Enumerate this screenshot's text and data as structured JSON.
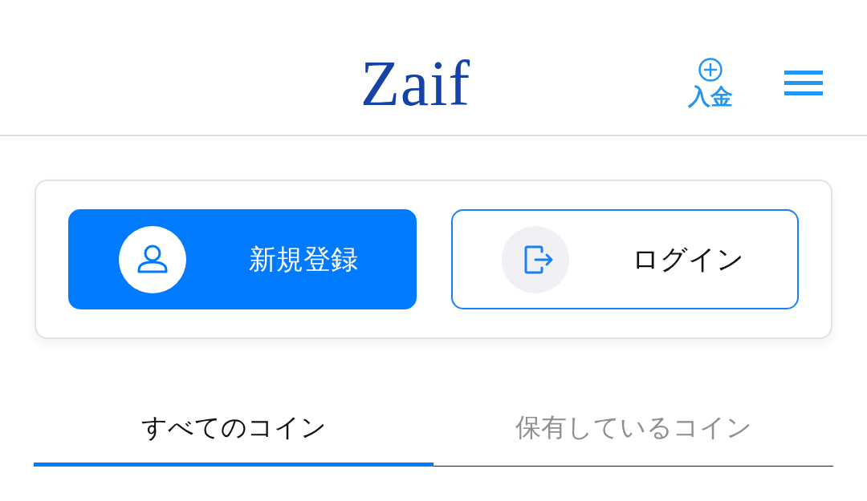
{
  "header": {
    "logo": "Zaif",
    "deposit": {
      "label": "入金"
    }
  },
  "auth": {
    "buttons": [
      {
        "kind": "register",
        "label": "新規登録"
      },
      {
        "kind": "login",
        "label": "ログイン"
      }
    ]
  },
  "tabs": [
    {
      "label": "すべてのコイン",
      "selected": true
    },
    {
      "label": "保有しているコイン",
      "selected": false
    }
  ]
}
